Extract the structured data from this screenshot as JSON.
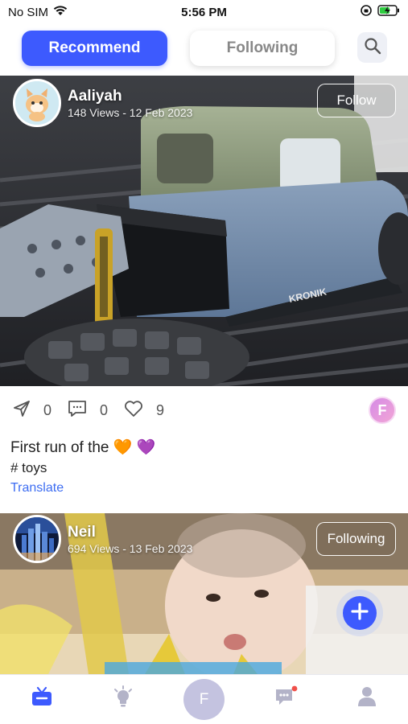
{
  "status_bar": {
    "carrier": "No SIM",
    "time": "5:56 PM",
    "icons": [
      "wifi-icon",
      "orientation-lock-icon",
      "battery-charging-icon"
    ]
  },
  "top_nav": {
    "tabs": [
      {
        "label": "Recommend",
        "active": true
      },
      {
        "label": "Following",
        "active": false
      }
    ],
    "search_icon": "search-icon",
    "accent_color": "#3d5afe"
  },
  "posts": [
    {
      "author": "Aaliyah",
      "meta": "148 Views - 12 Feb 2023",
      "follow_label": "Follow",
      "shares": "0",
      "comments": "0",
      "likes": "9",
      "liker_initial": "F",
      "caption": "First run of the 🧡 💜",
      "hashtag": "# toys",
      "translate_label": "Translate"
    },
    {
      "author": "Neil",
      "meta": "694 Views - 13 Feb 2023",
      "follow_label": "Following"
    }
  ],
  "bottom_nav": {
    "items": [
      "tv-icon",
      "lightbulb-icon",
      "profile-center",
      "chat-icon",
      "user-icon"
    ],
    "center_initial": "F",
    "active_color": "#3d5afe"
  }
}
